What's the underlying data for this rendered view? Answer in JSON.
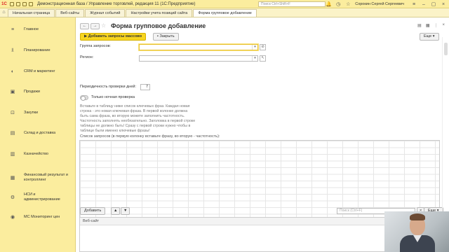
{
  "titlebar": {
    "logo": "1С",
    "title": "Демонстрационная база / Управление торговлей, редакция 11   (1С:Предприятие)",
    "search_placeholder": "Поиск Ctrl+Shift+F",
    "user": "Сорокин Сергей Сергеевич"
  },
  "tabs": [
    {
      "label": "Начальная страница"
    },
    {
      "label": "Веб-сайты"
    },
    {
      "label": "Журнал событий"
    },
    {
      "label": "Настройки учета позиций сайта"
    },
    {
      "label": "Форма групповое добавление"
    }
  ],
  "sidebar": {
    "items": [
      {
        "label": "Главное",
        "icon": "menu-icon"
      },
      {
        "label": "Планирование",
        "icon": "chart-icon"
      },
      {
        "label": "CRM и маркетинг",
        "icon": "crm-icon"
      },
      {
        "label": "Продажи",
        "icon": "sales-icon"
      },
      {
        "label": "Закупки",
        "icon": "cart-icon"
      },
      {
        "label": "Склад и доставка",
        "icon": "warehouse-icon"
      },
      {
        "label": "Казначейство",
        "icon": "treasury-icon"
      },
      {
        "label": "Финансовый результат и контроллинг",
        "icon": "finance-icon"
      },
      {
        "label": "НСИ и администрирование",
        "icon": "admin-icon"
      },
      {
        "label": "МС Мониторинг цен",
        "icon": "monitoring-icon"
      }
    ]
  },
  "form": {
    "title": "Форма групповое добавление",
    "more_label": "Еще",
    "add_button": "Добавить запросы массово",
    "close_button": "Закрыть",
    "group_label": "Группа запросов:",
    "region_label": "Регион:",
    "period_label": "Периодичность проверки дней:",
    "period_value": "7",
    "night_label": "Только ночная проверка",
    "hint_lines": [
      "Вставьте в таблицу ниже список ключевых фраз. Каждая новая",
      "строка - это новая ключевая фраза. В первой колонке должна",
      "быть сама фраза, во вторую можете заполнить частотность.",
      "Частотность заполнять необязательно. Заголовка в первой строке",
      "таблицы не должно быть! Сразу с первой строки нужно чтобы в",
      "таблице были именно ключевые фразы!"
    ],
    "grid_label": "Список запросов (в первую колонку вставьте фразу, во вторую - частотность):",
    "add_row_button": "Добавить",
    "search_placeholder": "Поиск (Ctrl+F)",
    "sites_header": "Веб-сайт"
  }
}
